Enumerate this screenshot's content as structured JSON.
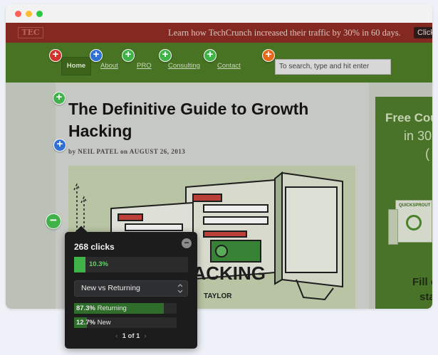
{
  "window": {
    "traffic_lights": [
      "#ff5f57",
      "#febc2e",
      "#28c840"
    ]
  },
  "site": {
    "logo_text": "TEC",
    "promo_text": "Learn how TechCrunch increased their traffic by 30% in 60 days.",
    "promo_button": "Click",
    "nav": {
      "home": "Home",
      "items": [
        "About",
        "PRO",
        "Consulting",
        "Contact"
      ]
    },
    "search_placeholder": "To search, type and hit enter",
    "article": {
      "title": "The Definitive Guide to Growth Hacking",
      "byline": "by NEIL PATEL on AUGUST 26, 2013",
      "hero_word": "GROWTH HACKING",
      "hero_caption": "TAYLOR"
    },
    "ad": {
      "line1": "Free Cour",
      "line2": "in 30",
      "line3": "(",
      "line4": "Fill ou",
      "line5": "sta",
      "brand": "QUICKSPROUT"
    }
  },
  "markers": [
    {
      "color": "#d0342c",
      "symbol": "+"
    },
    {
      "color": "#2f6fd6",
      "symbol": "+"
    },
    {
      "color": "#3fb24a",
      "symbol": "+"
    },
    {
      "color": "#3fb24a",
      "symbol": "+"
    },
    {
      "color": "#3fb24a",
      "symbol": "+"
    },
    {
      "color": "#e56a1c",
      "symbol": "+"
    },
    {
      "color": "#3fb24a",
      "symbol": "+"
    },
    {
      "color": "#2f6fd6",
      "symbol": "+"
    },
    {
      "color": "#3fb24a",
      "symbol": "−"
    }
  ],
  "popup": {
    "clicks": "268 clicks",
    "percent_label": "10.3%",
    "percent_value": 0.103,
    "select_value": "New vs Returning",
    "rows": [
      {
        "pct": "87.3%",
        "label": "Returning",
        "value": 0.873
      },
      {
        "pct": "12.7%",
        "label": "New",
        "value": 0.127
      }
    ],
    "pager": "1 of 1",
    "close_symbol": "−",
    "prev_symbol": "‹",
    "next_symbol": "›"
  }
}
